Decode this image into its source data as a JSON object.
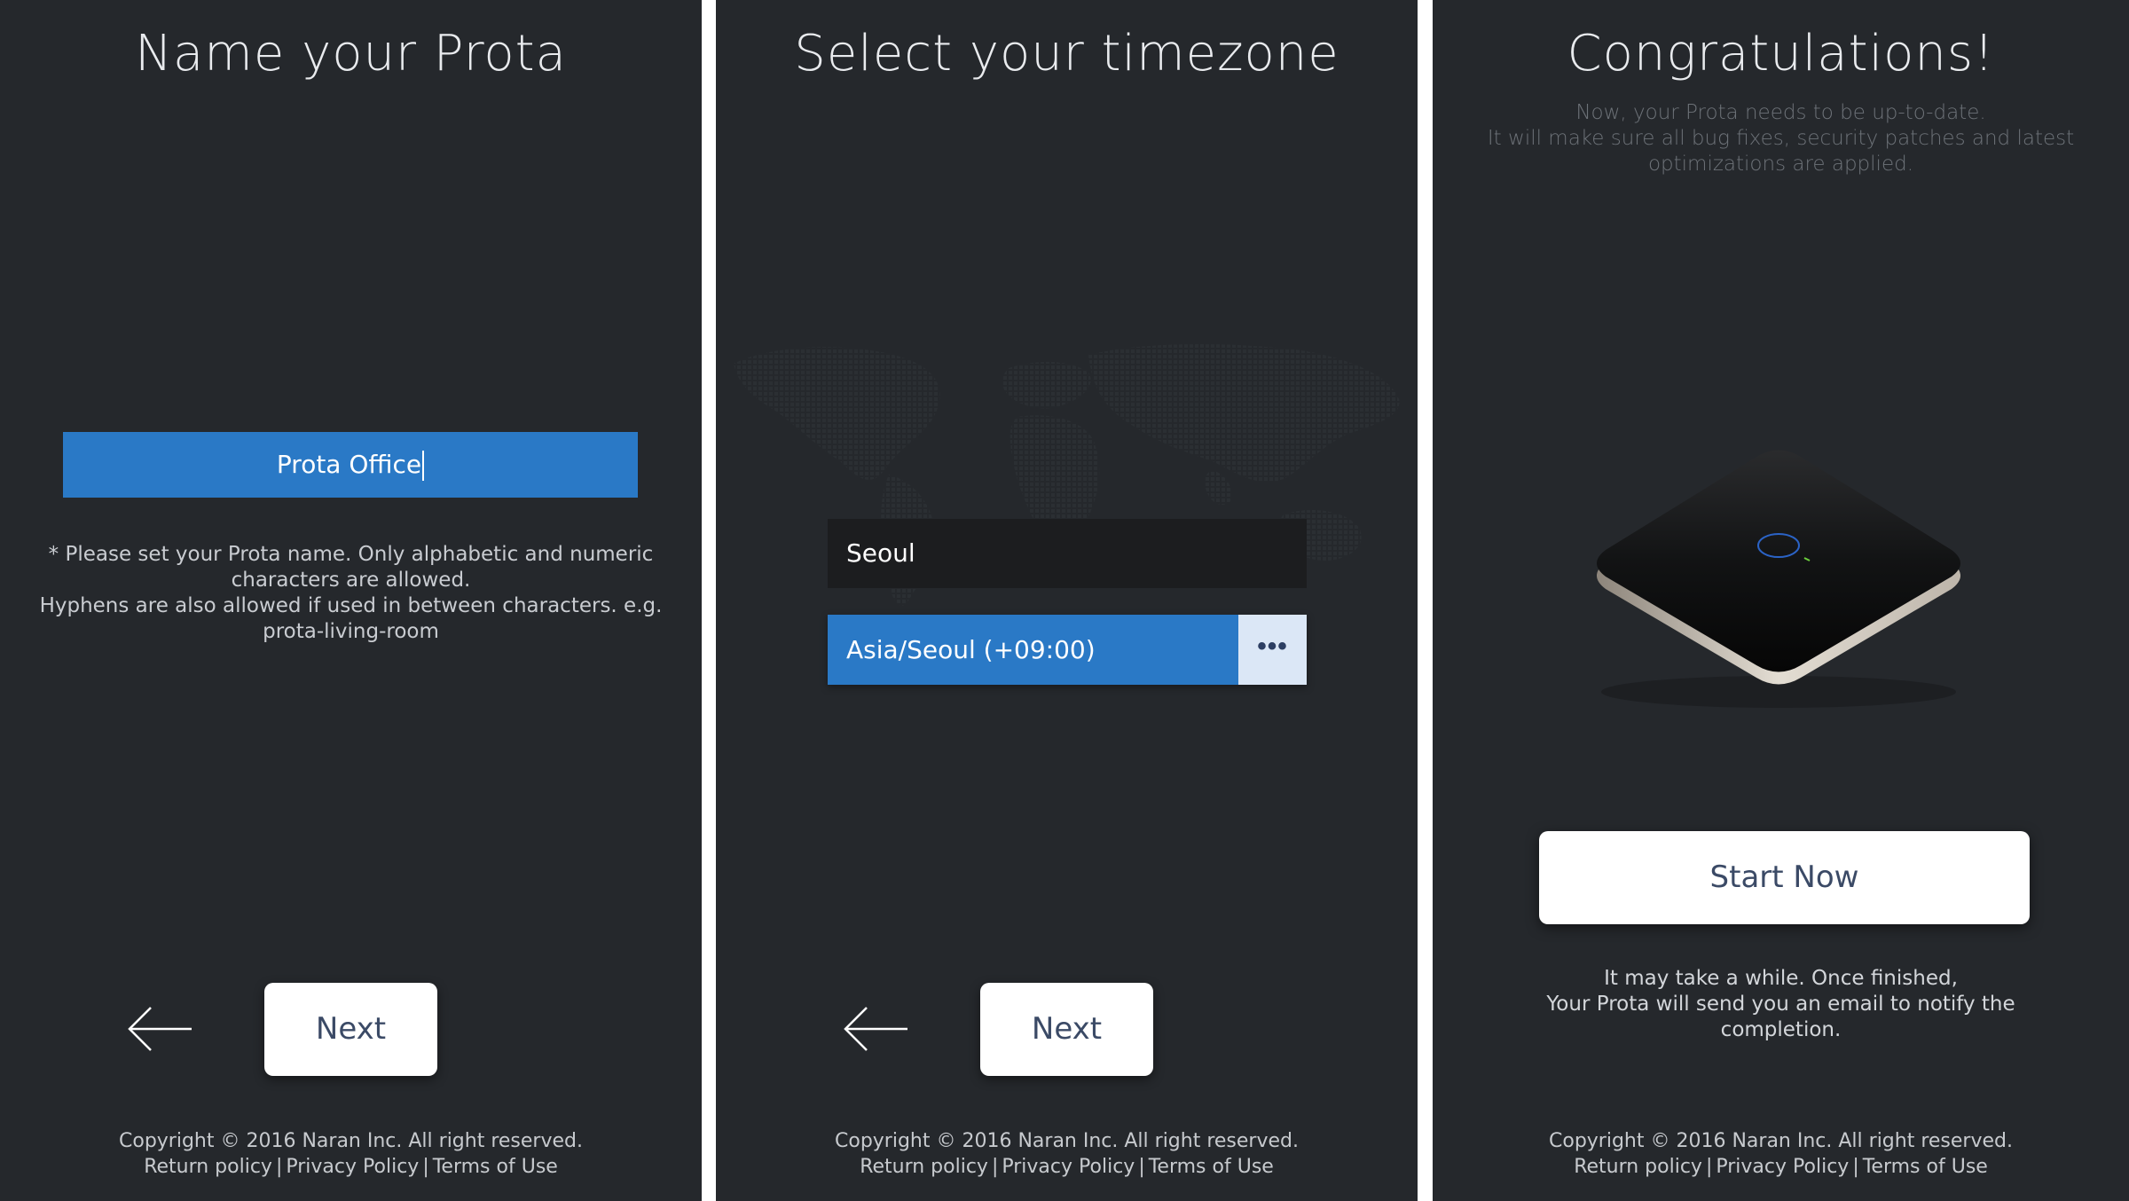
{
  "screens": [
    {
      "title": "Name your Prota",
      "name_input_value": "Prota Office",
      "hint_line1": "* Please set your Prota name. Only alphabetic and numeric characters are allowed.",
      "hint_line2": "Hyphens are also allowed if used in between characters. e.g. prota-living-room",
      "back_icon": "arrow-left-icon",
      "next_label": "Next"
    },
    {
      "title": "Select your timezone",
      "search_value": "Seoul",
      "timezone_option": "Asia/Seoul (+09:00)",
      "more_label": "•••",
      "back_icon": "arrow-left-icon",
      "next_label": "Next"
    },
    {
      "title": "Congratulations!",
      "subtitle_line1": "Now, your Prota needs to be up-to-date.",
      "subtitle_line2": "It will make sure all bug fixes, security patches and latest optimizations are applied.",
      "device_image": "prota-device-image",
      "start_label": "Start Now",
      "note_line1": "It may take a while. Once finished,",
      "note_line2": "Your Prota will send you an email to notify the completion."
    }
  ],
  "footer": {
    "copyright": "Copyright © 2016 Naran Inc. All right reserved.",
    "return_policy": "Return policy",
    "privacy_policy": "Privacy Policy",
    "terms_of_use": "Terms of Use",
    "separator": "|"
  },
  "colors": {
    "panel_bg": "#25282c",
    "accent_blue": "#2a79c6",
    "divider": "#ffffff",
    "button_text": "#3b4a66"
  }
}
